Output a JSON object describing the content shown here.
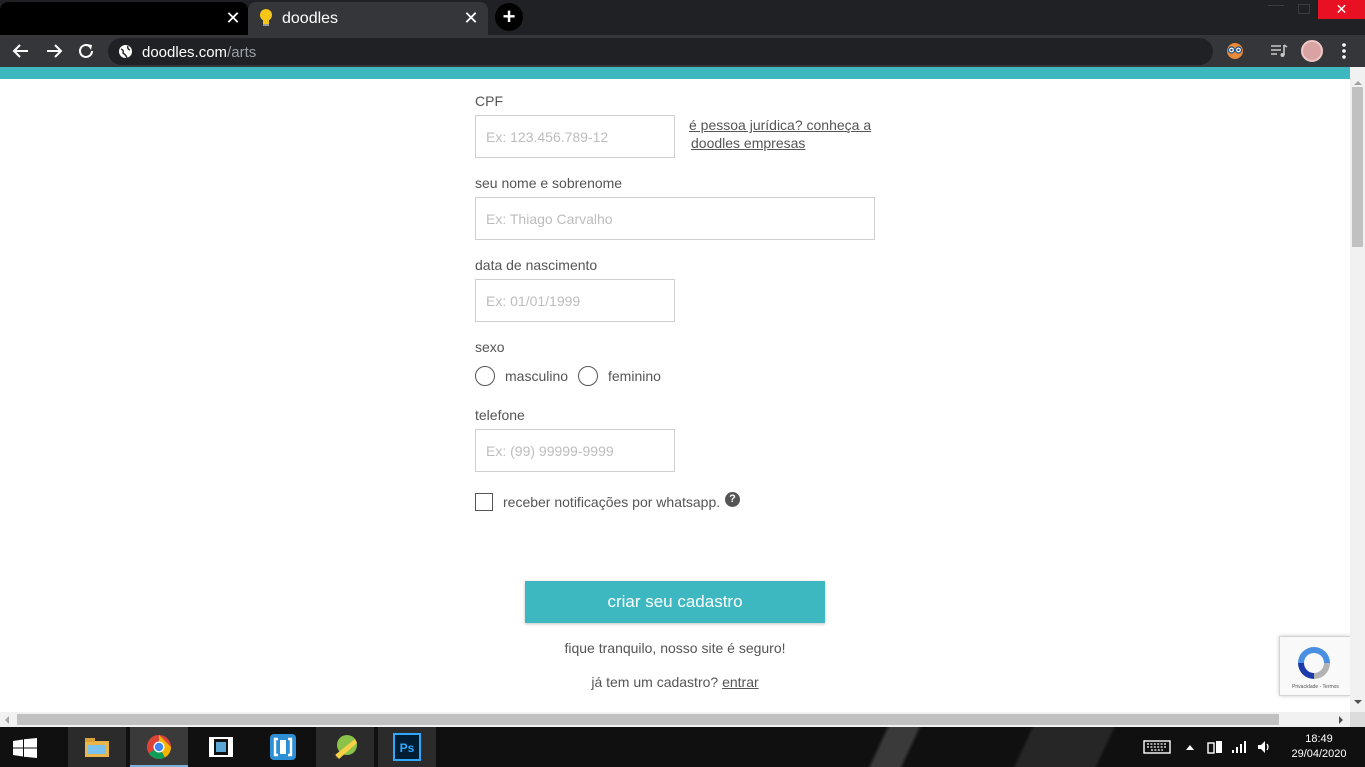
{
  "browser": {
    "tabs": [
      {
        "title": ""
      },
      {
        "title": "doodles"
      }
    ],
    "url_host": "doodles.com",
    "url_path": "/arts"
  },
  "form": {
    "cpf_label": "CPF",
    "cpf_placeholder": "Ex: 123.456.789-12",
    "pj_link_line1": "é pessoa jurídica? conheça a",
    "pj_link_line2": "doodles empresas",
    "name_label": "seu nome e sobrenome",
    "name_placeholder": "Ex: Thiago Carvalho",
    "birth_label": "data de nascimento",
    "birth_placeholder": "Ex: 01/01/1999",
    "sex_label": "sexo",
    "sex_options": [
      "masculino",
      "feminino"
    ],
    "phone_label": "telefone",
    "phone_placeholder": "Ex: (99) 99999-9999",
    "whatsapp_label": "receber notificações por whatsapp.",
    "help_symbol": "?",
    "submit_label": "criar seu cadastro",
    "secure_text": "fique tranquilo, nosso site é seguro!",
    "login_prompt": "já tem um cadastro?",
    "login_link": "entrar"
  },
  "recaptcha": {
    "terms": "Privacidade - Termos"
  },
  "taskbar": {
    "apps": [
      "file-explorer",
      "chrome",
      "video-editor",
      "code-editor",
      "game",
      "photoshop"
    ],
    "photoshop_label": "Ps",
    "time": "18:49",
    "date": "29/04/2020"
  },
  "colors": {
    "accent": "#3db8c1",
    "text": "#555555",
    "chrome_dark": "#202124",
    "chrome_toolbar": "#35363a"
  }
}
